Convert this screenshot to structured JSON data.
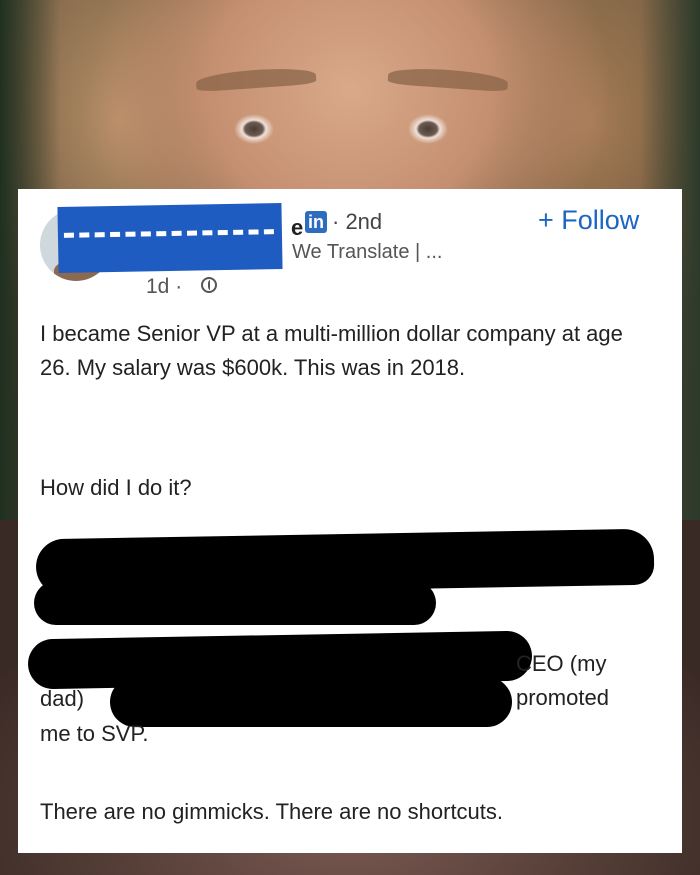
{
  "post": {
    "name_fragment": "e",
    "network_badge": "in",
    "degree": "· 2nd",
    "headline": "We Translate | ...",
    "follow_label": "+ Follow",
    "time": "1d ·",
    "body_p1": "I became Senior VP at a multi-million dollar company at age 26. My salary was $600k. This was in 2018.",
    "body_p2": "How did I do it?",
    "body_ceo": "CEO (my promoted",
    "body_dad": "dad)",
    "body_svp": "me to SVP.",
    "body_p3": "There are no gimmicks. There are no shortcuts."
  },
  "colors": {
    "follow_blue": "#1a66c2",
    "redaction_blue": "#1f5cc2",
    "linkedin_blue": "#2e6dbd"
  }
}
